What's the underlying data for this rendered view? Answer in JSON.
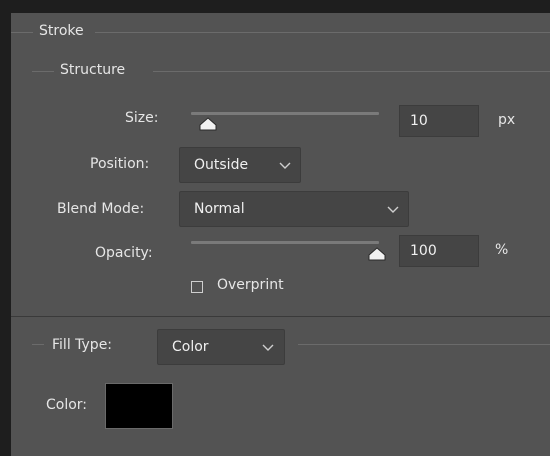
{
  "stroke_title": "Stroke",
  "structure_title": "Structure",
  "size": {
    "label": "Size:",
    "value": "10",
    "unit": "px",
    "slider_fraction": 0.04
  },
  "position": {
    "label": "Position:",
    "selected": "Outside"
  },
  "blend_mode": {
    "label": "Blend Mode:",
    "selected": "Normal"
  },
  "opacity": {
    "label": "Opacity:",
    "value": "100",
    "unit": "%",
    "slider_fraction": 1.0
  },
  "overprint": {
    "label": "Overprint",
    "checked": false
  },
  "fill_type": {
    "label": "Fill Type:",
    "selected": "Color"
  },
  "color": {
    "label": "Color:",
    "swatch": "#000000"
  }
}
